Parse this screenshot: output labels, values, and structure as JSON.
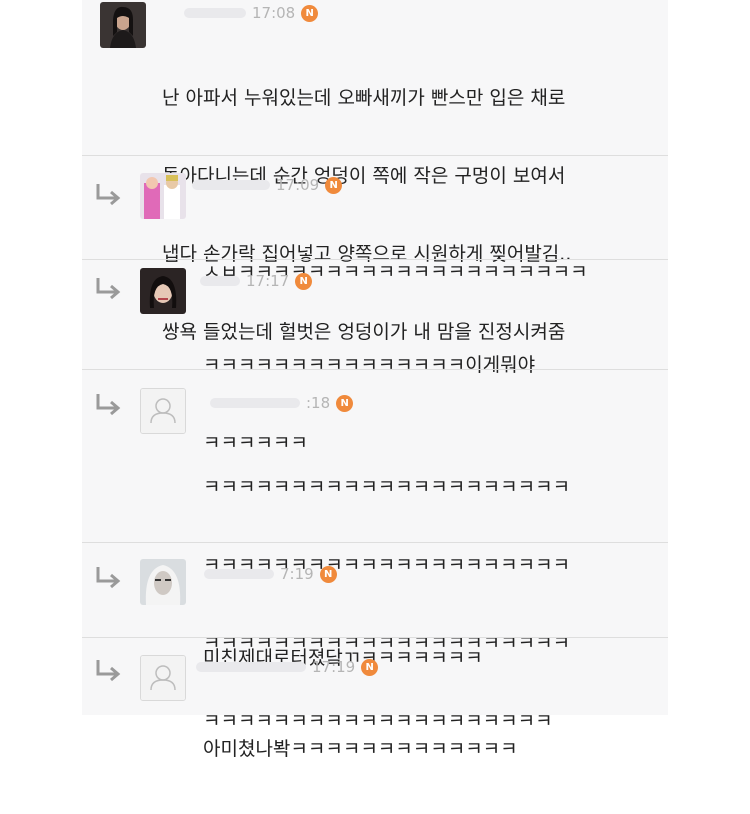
{
  "comments": [
    {
      "time": "17:08",
      "badge": "N",
      "avatar": "user-photo-avatar",
      "lines": [
        "난 아파서 누워있는데 오빠새끼가 빤스만 입은 채로",
        "돌아다니는데 순간 엉덩이 쪽에 작은 구멍이 보여서",
        "냅다 손가락 집어넣고 양쪽으로 시원하게 찢어발김..",
        "쌍욕 들었는데 헐벗은 엉덩이가 내 맘을 진정시켜줌"
      ]
    },
    {
      "time": "17:09",
      "badge": "N",
      "avatar": "user-photo-avatar",
      "reply_icon": "reply-arrow-icon",
      "lines": [
        "ㅅㅂㅋㅋㅋㅋㅋㅋㅋㅋㅋㅋㅋㅋㅋㅋㅋㅋㅋㅋㅋㅋ"
      ]
    },
    {
      "time": "17:17",
      "badge": "N",
      "avatar": "user-photo-avatar",
      "reply_icon": "reply-arrow-icon",
      "lines": [
        "ㅋㅋㅋㅋㅋㅋㅋㅋㅋㅋㅋㅋㅋㅋㅋ이게뭐야",
        "ㅋㅋㅋㅋㅋㅋ"
      ]
    },
    {
      "time": ":18",
      "badge": "N",
      "avatar": "default-user-icon",
      "reply_icon": "reply-arrow-icon",
      "lines": [
        "ㅋㅋㅋㅋㅋㅋㅋㅋㅋㅋㅋㅋㅋㅋㅋㅋㅋㅋㅋㅋㅋ",
        "ㅋㅋㅋㅋㅋㅋㅋㅋㅋㅋㅋㅋㅋㅋㅋㅋㅋㅋㅋㅋㅋ",
        "ㅋㅋㅋㅋㅋㅋㅋㅋㅋㅋㅋㅋㅋㅋㅋㅋㅋㅋㅋㅋㅋ",
        "ㅋㅋㅋㅋㅋㅋㅋㅋㅋㅋㅋㅋㅋㅋㅋㅋㅋㅋㅋㅋ"
      ]
    },
    {
      "time": "7:19",
      "badge": "N",
      "avatar": "user-photo-avatar",
      "reply_icon": "reply-arrow-icon",
      "lines": [
        "미친제대로터졌닼ㄲㅋㅋㅋㅋㅋㅋㅋ"
      ]
    },
    {
      "time": "17:19",
      "badge": "N",
      "avatar": "default-user-icon",
      "reply_icon": "reply-arrow-icon",
      "lines": [
        "아미쳤나봑ㅋㅋㅋㅋㅋㅋㅋㅋㅋㅋㅋㅋㅋ"
      ]
    }
  ],
  "colors": {
    "badge": "#f08a3c",
    "meta_text": "#b5b5b5",
    "body_text": "#222222",
    "feed_bg": "#f7f7f8",
    "divider": "#dedede"
  }
}
